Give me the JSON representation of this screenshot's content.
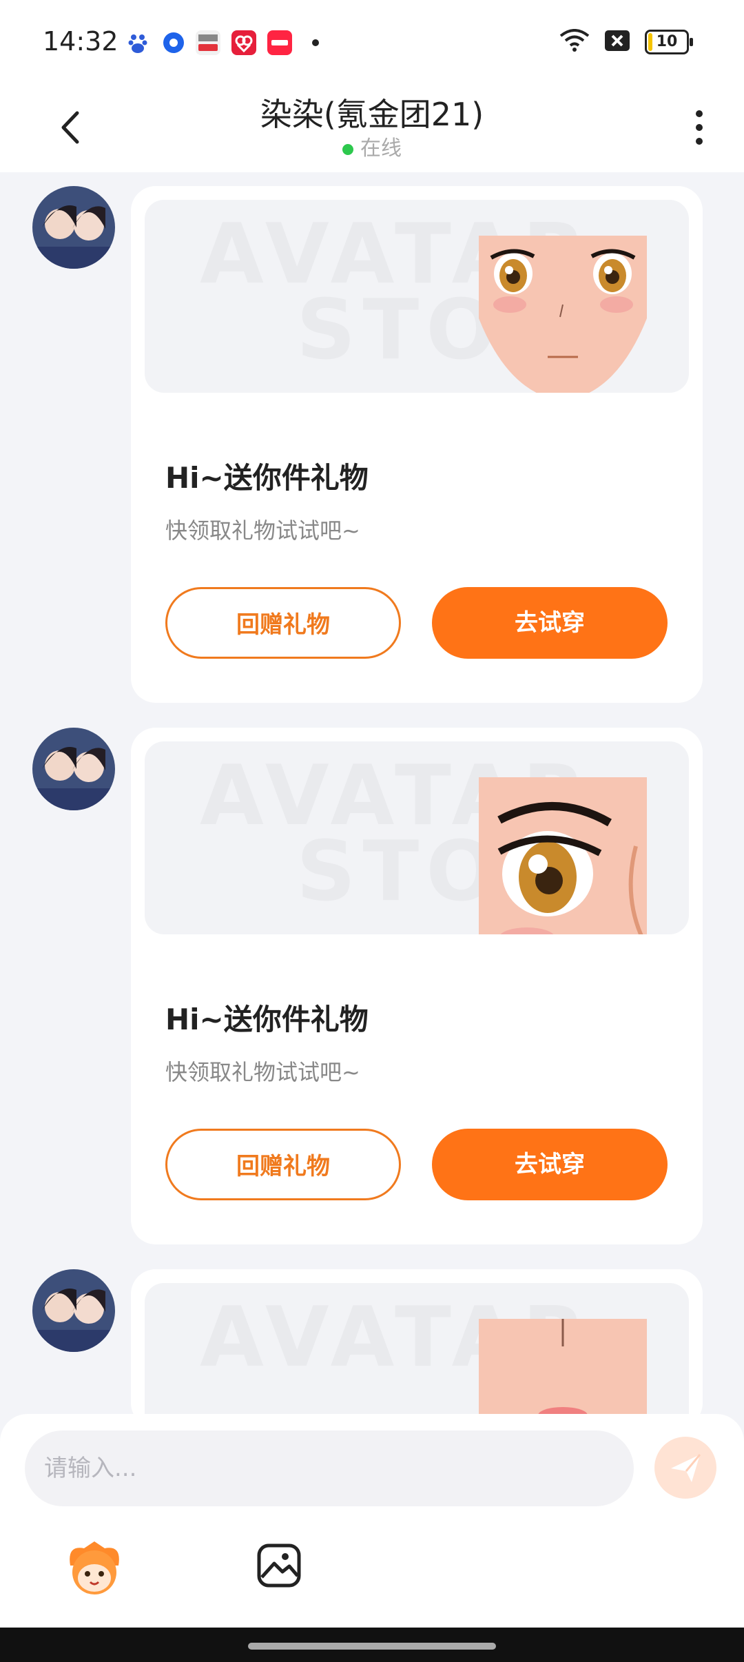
{
  "status_bar": {
    "time": "14:32",
    "battery": "10"
  },
  "header": {
    "title": "染染(氪金团21)",
    "online_status": "在线"
  },
  "messages": [
    {
      "title": "Hi~送你件礼物",
      "subtitle": "快领取礼物试试吧~",
      "return_gift": "回赠礼物",
      "try_on": "去试穿"
    },
    {
      "title": "Hi~送你件礼物",
      "subtitle": "快领取礼物试试吧~",
      "return_gift": "回赠礼物",
      "try_on": "去试穿"
    },
    {
      "title": "",
      "subtitle": "",
      "return_gift": "",
      "try_on": ""
    }
  ],
  "input": {
    "placeholder": "请输入..."
  },
  "colors": {
    "accent": "#ff7316",
    "online": "#2dc84d"
  },
  "icons": [
    "back-arrow-icon",
    "more-vertical-icon",
    "send-icon",
    "mascot-icon",
    "image-icon"
  ]
}
